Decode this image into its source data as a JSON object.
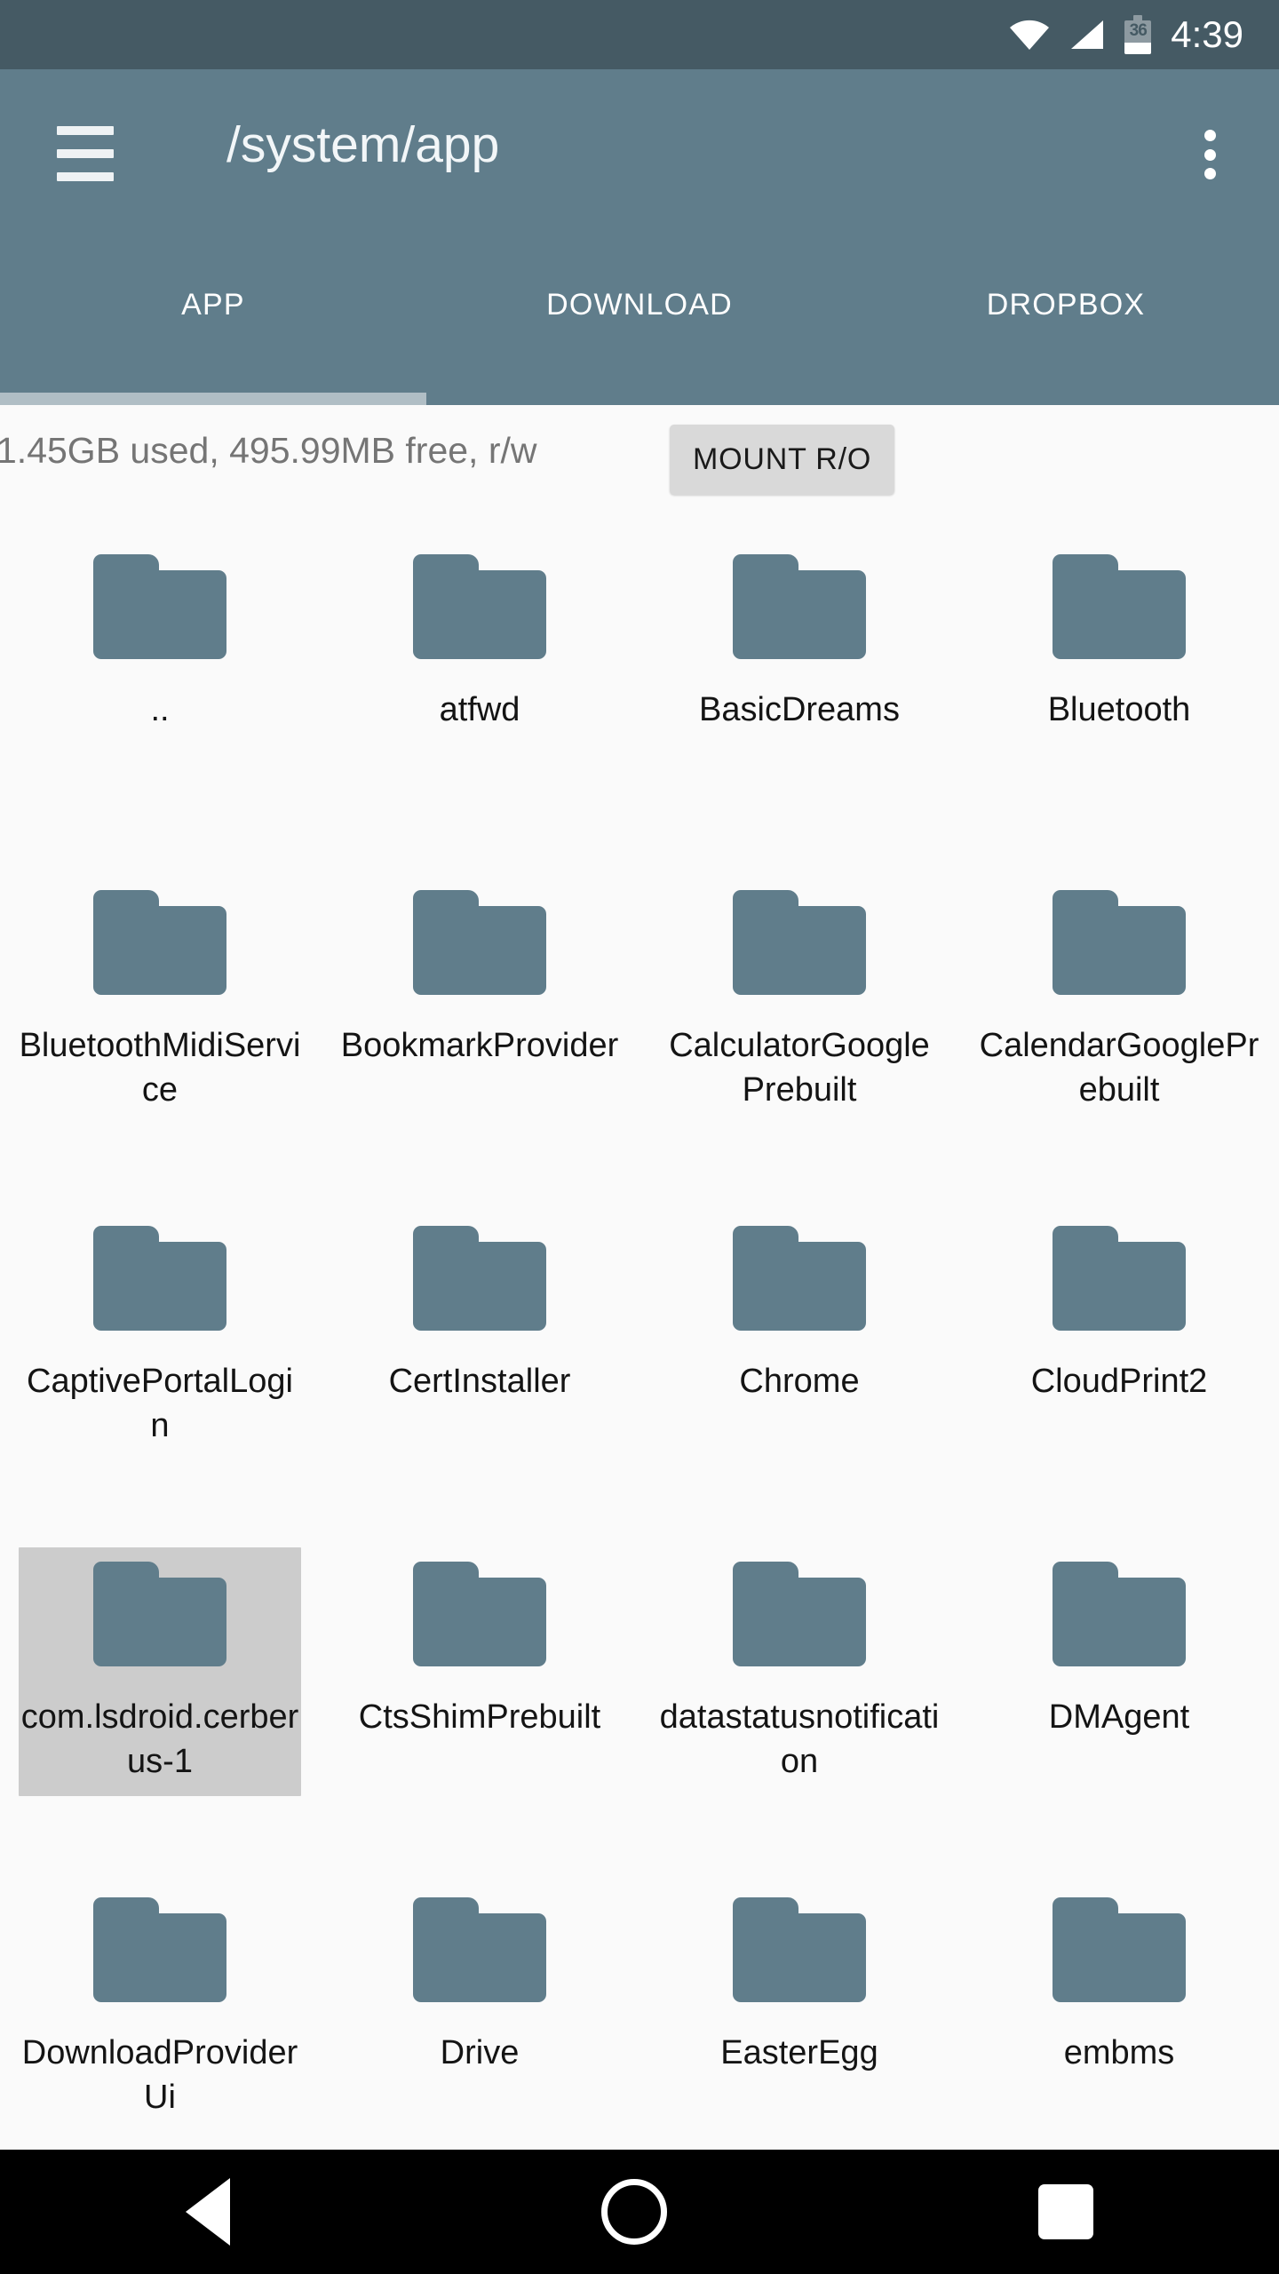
{
  "status_bar": {
    "wifi_icon": "wifi-icon",
    "signal_icon": "cell-signal-icon",
    "battery_icon": "battery-icon",
    "battery_level": "36",
    "time": "4:39"
  },
  "app_bar": {
    "menu_icon": "hamburger-menu-icon",
    "title": "/system/app",
    "overflow_icon": "overflow-menu-icon"
  },
  "tabs": {
    "active_index": 0,
    "items": [
      {
        "label": "APP"
      },
      {
        "label": "DOWNLOAD"
      },
      {
        "label": "DROPBOX"
      }
    ]
  },
  "storage": {
    "info": "1.45GB used, 495.99MB free, r/w",
    "mount_button": "MOUNT R/O"
  },
  "files": [
    {
      "name": "..",
      "type": "folder",
      "selected": false
    },
    {
      "name": "atfwd",
      "type": "folder",
      "selected": false
    },
    {
      "name": "BasicDreams",
      "type": "folder",
      "selected": false
    },
    {
      "name": "Bluetooth",
      "type": "folder",
      "selected": false
    },
    {
      "name": "BluetoothMidiService",
      "type": "folder",
      "selected": false
    },
    {
      "name": "BookmarkProvider",
      "type": "folder",
      "selected": false
    },
    {
      "name": "CalculatorGooglePrebuilt",
      "type": "folder",
      "selected": false
    },
    {
      "name": "CalendarGooglePrebuilt",
      "type": "folder",
      "selected": false
    },
    {
      "name": "CaptivePortalLogin",
      "type": "folder",
      "selected": false
    },
    {
      "name": "CertInstaller",
      "type": "folder",
      "selected": false
    },
    {
      "name": "Chrome",
      "type": "folder",
      "selected": false
    },
    {
      "name": "CloudPrint2",
      "type": "folder",
      "selected": false
    },
    {
      "name": "com.lsdroid.cerberus-1",
      "type": "folder",
      "selected": true
    },
    {
      "name": "CtsShimPrebuilt",
      "type": "folder",
      "selected": false
    },
    {
      "name": "datastatusnotification",
      "type": "folder",
      "selected": false
    },
    {
      "name": "DMAgent",
      "type": "folder",
      "selected": false
    },
    {
      "name": "DownloadProviderUi",
      "type": "folder",
      "selected": false
    },
    {
      "name": "Drive",
      "type": "folder",
      "selected": false
    },
    {
      "name": "EasterEgg",
      "type": "folder",
      "selected": false
    },
    {
      "name": "embms",
      "type": "folder",
      "selected": false
    }
  ],
  "nav_bar": {
    "back_icon": "back-triangle-icon",
    "home_icon": "home-circle-icon",
    "recents_icon": "recents-square-icon"
  },
  "colors": {
    "status_bar": "#455a64",
    "app_bar": "#607d8b",
    "tab_indicator": "#b0bec5",
    "folder": "#607d8b",
    "selection": "#cccccc",
    "page_background": "#fafafa",
    "nav_bar": "#000000"
  }
}
